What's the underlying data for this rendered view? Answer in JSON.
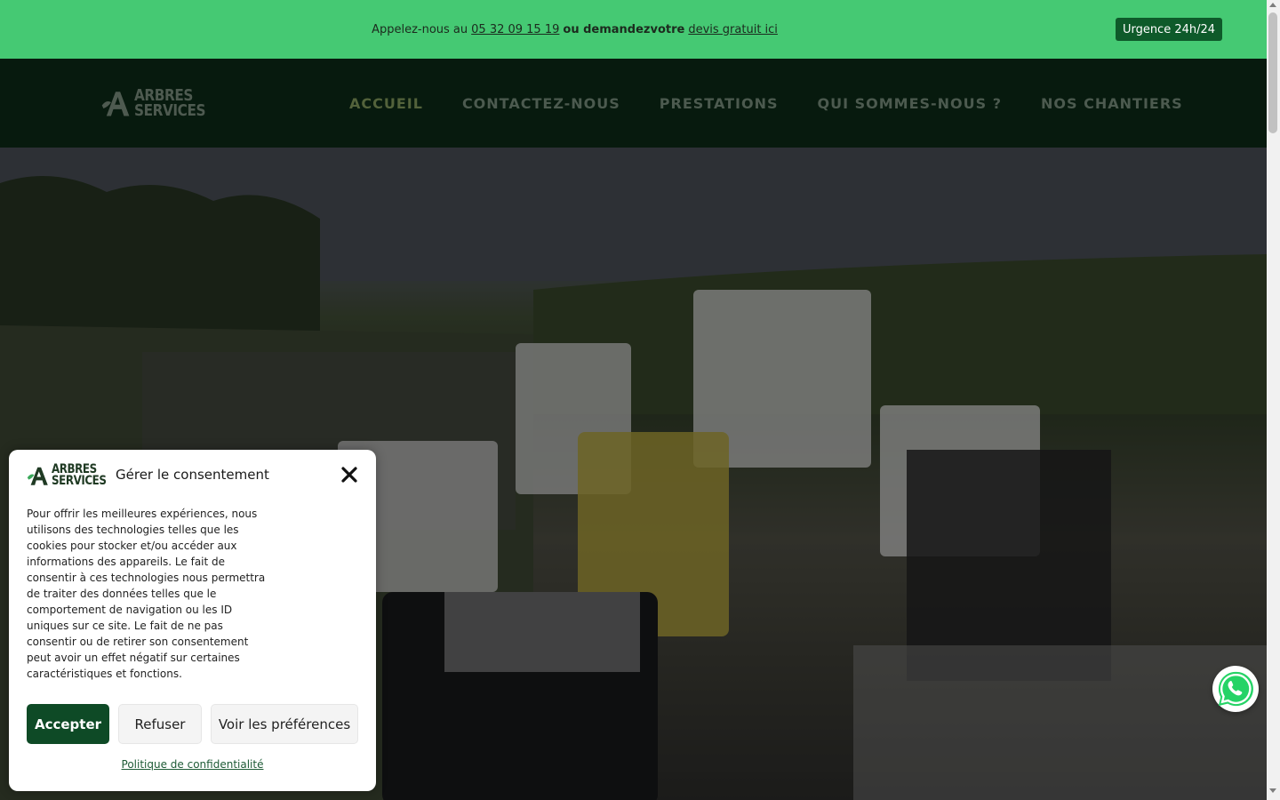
{
  "topbar": {
    "prefix": "Appelez-nous au",
    "phone": "05 32 09 15 19",
    "middle": "ou demandezvotre",
    "quote_link": "devis gratuit ici",
    "urgent_button": "Urgence 24h/24"
  },
  "header": {
    "logo_line1": "ARBRES",
    "logo_line2": "SERVICES",
    "nav": [
      "ACCUEIL",
      "CONTACTEZ-NOUS",
      "PRESTATIONS",
      "QUI SOMMES-NOUS ?",
      "NOS CHANTIERS"
    ]
  },
  "hero": {
    "image": "work-vehicles-photo"
  },
  "consent": {
    "logo_line1": "ARBRES",
    "logo_line2": "SERVICES",
    "title": "Gérer le consentement",
    "body": "Pour offrir les meilleures expériences, nous utilisons des technologies telles que les cookies pour stocker et/ou accéder aux informations des appareils. Le fait de consentir à ces technologies nous permettra de traiter des données telles que le comportement de navigation ou les ID uniques sur ce site. Le fait de ne pas consentir ou de retirer son consentement peut avoir un effet négatif sur certaines caractéristiques et fonctions.",
    "accept": "Accepter",
    "refuse": "Refuser",
    "preferences": "Voir les préférences",
    "privacy_link": "Politique de confidentialité"
  },
  "colors": {
    "topbar": "#45c973",
    "header": "#071a0e",
    "accent": "#0e4a26"
  },
  "icons": [
    "close-icon",
    "whatsapp-icon",
    "logo-icon"
  ]
}
